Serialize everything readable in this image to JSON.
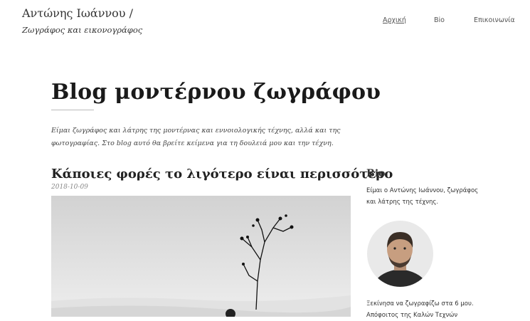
{
  "header": {
    "site_title": "Αντώνης Ιωάννου /",
    "tagline": "Ζωγράφος και εικονογράφος"
  },
  "nav": {
    "items": [
      {
        "label": "Αρχική"
      },
      {
        "label": "Bio"
      },
      {
        "label": "Επικοινωνία"
      }
    ]
  },
  "main": {
    "title": "Blog μοντέρνου ζωγράφου",
    "intro": "Είμαι ζωγράφος και λάτρης της μοντέρνας και εννοιολογικής τέχνης, αλλά και της φωτογραφίας. Στο blog αυτό θα βρείτε κείμενα για τη δουλειά μου και την τέχνη.",
    "post": {
      "title": "Κάποιες φορές το λιγότερο είναι περισσότερο",
      "date": "2018-10-09"
    }
  },
  "sidebar": {
    "title": "Bio",
    "intro": "Είμαι ο Αντώνης Ιωάννου, ζωγράφος και λάτρης της τέχνης.",
    "text": "Ξεκίνησα να ζωγραφίζω στα 6 μου. Απόφοιτος της Καλών Τεχνών"
  }
}
